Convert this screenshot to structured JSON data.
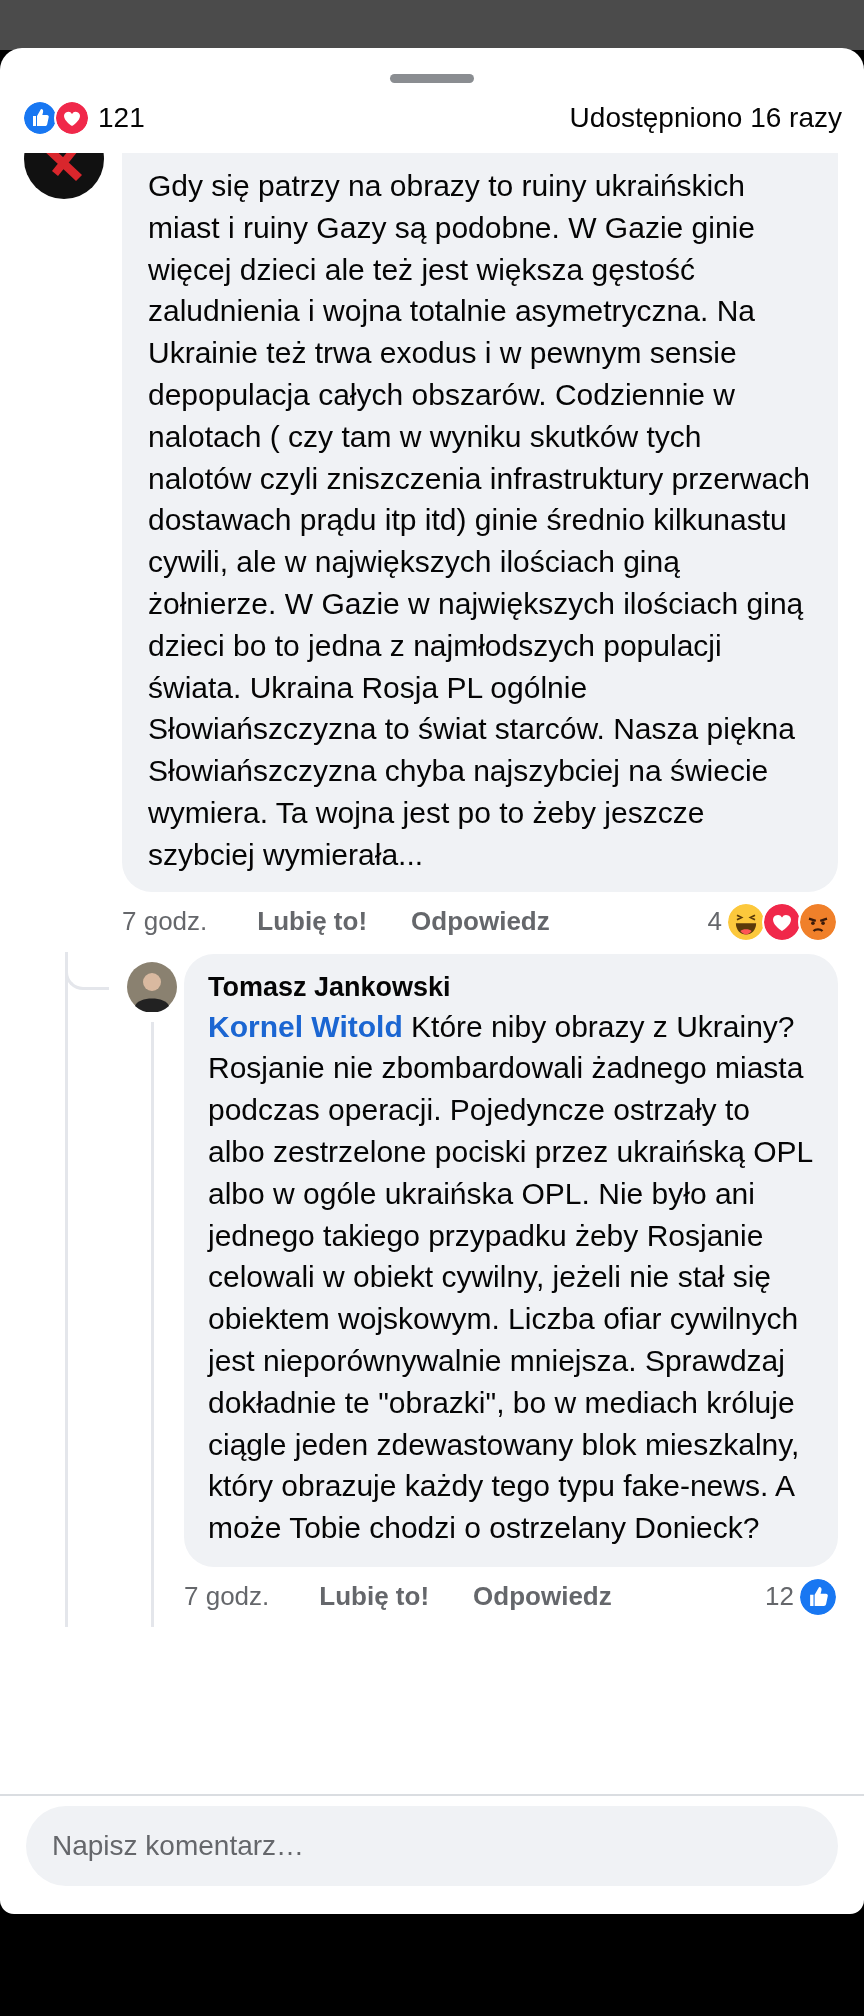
{
  "header": {
    "reactions": [
      {
        "kind": "like"
      },
      {
        "kind": "love"
      }
    ],
    "reactions_count": "121",
    "shares": "Udostępniono 16 razy"
  },
  "comments": [
    {
      "text": "Gdy się patrzy na obrazy to ruiny ukraińskich miast i ruiny Gazy są podobne. W Gazie ginie więcej dzieci ale też jest większa gęstość zaludnienia i wojna totalnie asymetryczna. Na Ukrainie też trwa exodus i w pewnym sensie depopulacja całych obszarów. Codziennie w nalotach ( czy tam w wyniku skutków tych nalotów czyli zniszczenia infrastruktury przerwach dostawach prądu itp itd) ginie średnio kilkunastu cywili, ale w największych ilościach giną żołnierze. W Gazie w największych ilościach giną dzieci bo to jedna z najmłodszych populacji świata. Ukraina Rosja PL ogólnie Słowiańszczyzna to świat starców. Nasza piękna Słowiańszczyzna chyba najszybciej na świecie wymiera. Ta wojna jest po to żeby jeszcze szybciej wymierała...",
      "time": "7 godz.",
      "like_label": "Lubię to!",
      "reply_label": "Odpowiedz",
      "reaction_count": "4",
      "reactions": [
        {
          "kind": "haha"
        },
        {
          "kind": "love"
        },
        {
          "kind": "angry"
        }
      ],
      "replies": [
        {
          "author": "Tomasz Jankowski",
          "mention": "Kornel Witold",
          "text": "Które niby obrazy z Ukrainy? Rosjanie nie zbombardowali żadnego miasta podczas operacji. Pojedyncze ostrzały to albo zestrzelone pociski przez ukraińską OPL albo w ogóle ukraińska OPL. Nie było ani jednego takiego przypadku żeby Rosjanie celowali w obiekt cywilny, jeżeli nie stał się obiektem wojskowym. Liczba ofiar cywilnych jest nieporównywalnie mniejsza. Sprawdzaj dokładnie te \"obrazki\", bo w mediach króluje ciągle jeden zdewastowany blok mieszkalny, który obrazuje każdy tego typu fake-news. A może Tobie chodzi o ostrzelany Donieck?",
          "time": "7 godz.",
          "like_label": "Lubię to!",
          "reply_label": "Odpowiedz",
          "reaction_count": "12",
          "reactions": [
            {
              "kind": "like"
            }
          ]
        }
      ]
    }
  ],
  "composer": {
    "placeholder": "Napisz komentarz…"
  }
}
